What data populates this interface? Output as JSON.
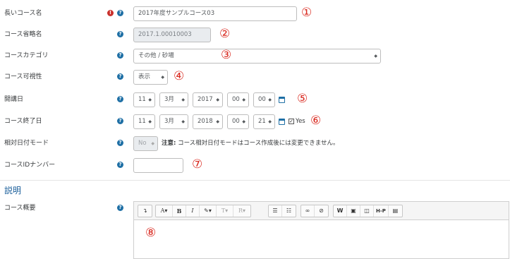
{
  "fields": {
    "fullname": {
      "label": "長いコース名",
      "required_glyph": "!",
      "help_glyph": "?",
      "value": "2017年度サンプルコース03",
      "marker": "①"
    },
    "shortname": {
      "label": "コース省略名",
      "help_glyph": "?",
      "value": "2017.1.00010003",
      "marker": "②"
    },
    "category": {
      "label": "コースカテゴリ",
      "help_glyph": "?",
      "value": "その他 / 砂場",
      "marker": "③"
    },
    "visibility": {
      "label": "コース可視性",
      "help_glyph": "?",
      "value": "表示",
      "marker": "④"
    },
    "startdate": {
      "label": "開講日",
      "help_glyph": "?",
      "day": "11",
      "month": "3月",
      "year": "2017",
      "hour": "00",
      "minute": "00",
      "marker": "⑤"
    },
    "enddate": {
      "label": "コース終了日",
      "help_glyph": "?",
      "day": "11",
      "month": "3月",
      "year": "2018",
      "hour": "00",
      "minute": "21",
      "enabled_label": "Yes",
      "marker": "⑥"
    },
    "relativedates": {
      "label": "相対日付モード",
      "help_glyph": "?",
      "value": "No",
      "note_strong": "注意:",
      "note_text": " コース相対日付モードはコース作成後には変更できません。"
    },
    "idnumber": {
      "label": "コースIDナンバー",
      "help_glyph": "?",
      "value": "",
      "marker": "⑦"
    }
  },
  "description_section": {
    "title": "説明",
    "summary": {
      "label": "コース概要",
      "help_glyph": "?",
      "marker": "⑧",
      "toolbar": {
        "collapse": "↴",
        "font_color": "A▾",
        "bold": "B",
        "italic": "I",
        "paint": "✎▾",
        "font_size": "T▾",
        "rtl": "R▾",
        "unordered_list": "☰",
        "ordered_list": "☷",
        "link": "∞",
        "unlink": "⊘",
        "media_w": "W",
        "image": "▣",
        "media": "◫",
        "hp_label": "H-P",
        "file": "▤"
      }
    }
  },
  "colors": {
    "accent": "#1e6fa5",
    "required": "#c9302c",
    "marker": "#d9281e",
    "section_title": "#1a5e9a"
  },
  "icons": {
    "required": "exclamation-circle-icon",
    "help": "question-circle-icon",
    "calendar": "calendar-icon",
    "dropdown": "chevron-down-icon"
  }
}
